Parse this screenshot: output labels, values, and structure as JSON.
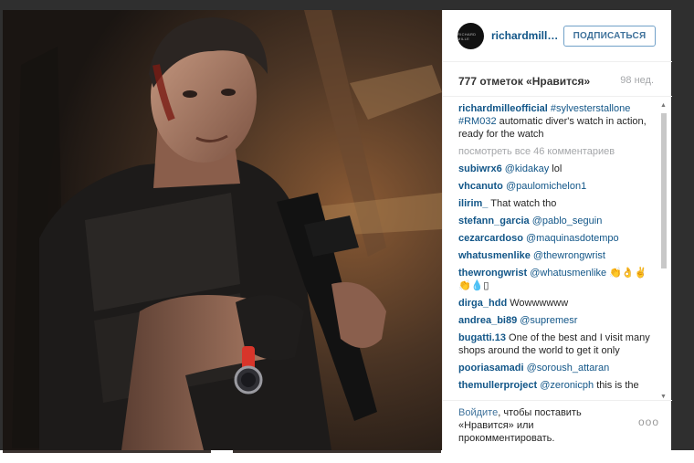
{
  "post": {
    "username": "richardmille...",
    "avatar_text": "RICHARD MILLE",
    "follow_label": "ПОДПИСАТЬСЯ",
    "likes": "777 отметок «Нравится»",
    "age": "98 нед."
  },
  "caption": {
    "user": "richardmilleofficial",
    "tag1": "#sylvesterstallone",
    "tag2": "#RM032",
    "text": "automatic diver's watch in action, ready for the watch"
  },
  "view_all": "посмотреть все 46 комментариев",
  "comments": [
    {
      "user": "subiwrx6",
      "mention": "@kidakay",
      "text": "lol"
    },
    {
      "user": "vhcanuto",
      "mention": "@paulomichelon1",
      "text": ""
    },
    {
      "user": "ilirim_",
      "mention": "",
      "text": "That watch tho"
    },
    {
      "user": "stefann_garcia",
      "mention": "@pablo_seguin",
      "text": ""
    },
    {
      "user": "cezarcardoso",
      "mention": "@maquinasdotempo",
      "text": ""
    },
    {
      "user": "whatusmenlike",
      "mention": "@thewrongwrist",
      "text": ""
    },
    {
      "user": "thewrongwrist",
      "mention": "@whatusmenlike",
      "text": "👏👌✌ 👏💧▯"
    },
    {
      "user": "dirga_hdd",
      "mention": "",
      "text": "Wowwwwww"
    },
    {
      "user": "andrea_bi89",
      "mention": "@supremesr",
      "text": ""
    },
    {
      "user": "bugatti.13",
      "mention": "",
      "text": "One of the best and I visit many shops around the world to get it only"
    },
    {
      "user": "pooriasamadi",
      "mention": "@soroush_attaran",
      "text": ""
    },
    {
      "user": "themullerproject",
      "mention": "@zeronicph",
      "text": "this is the"
    }
  ],
  "footer": {
    "login_link": "Войдите",
    "login_rest": ", чтобы поставить «Нравится» или прокомментировать.",
    "more": "ooo"
  },
  "icons": {
    "scroll_up": "▲",
    "scroll_down": "▼"
  },
  "colors": {
    "link": "#125688",
    "follow": "#3f729b",
    "muted": "#a5a7aa"
  }
}
